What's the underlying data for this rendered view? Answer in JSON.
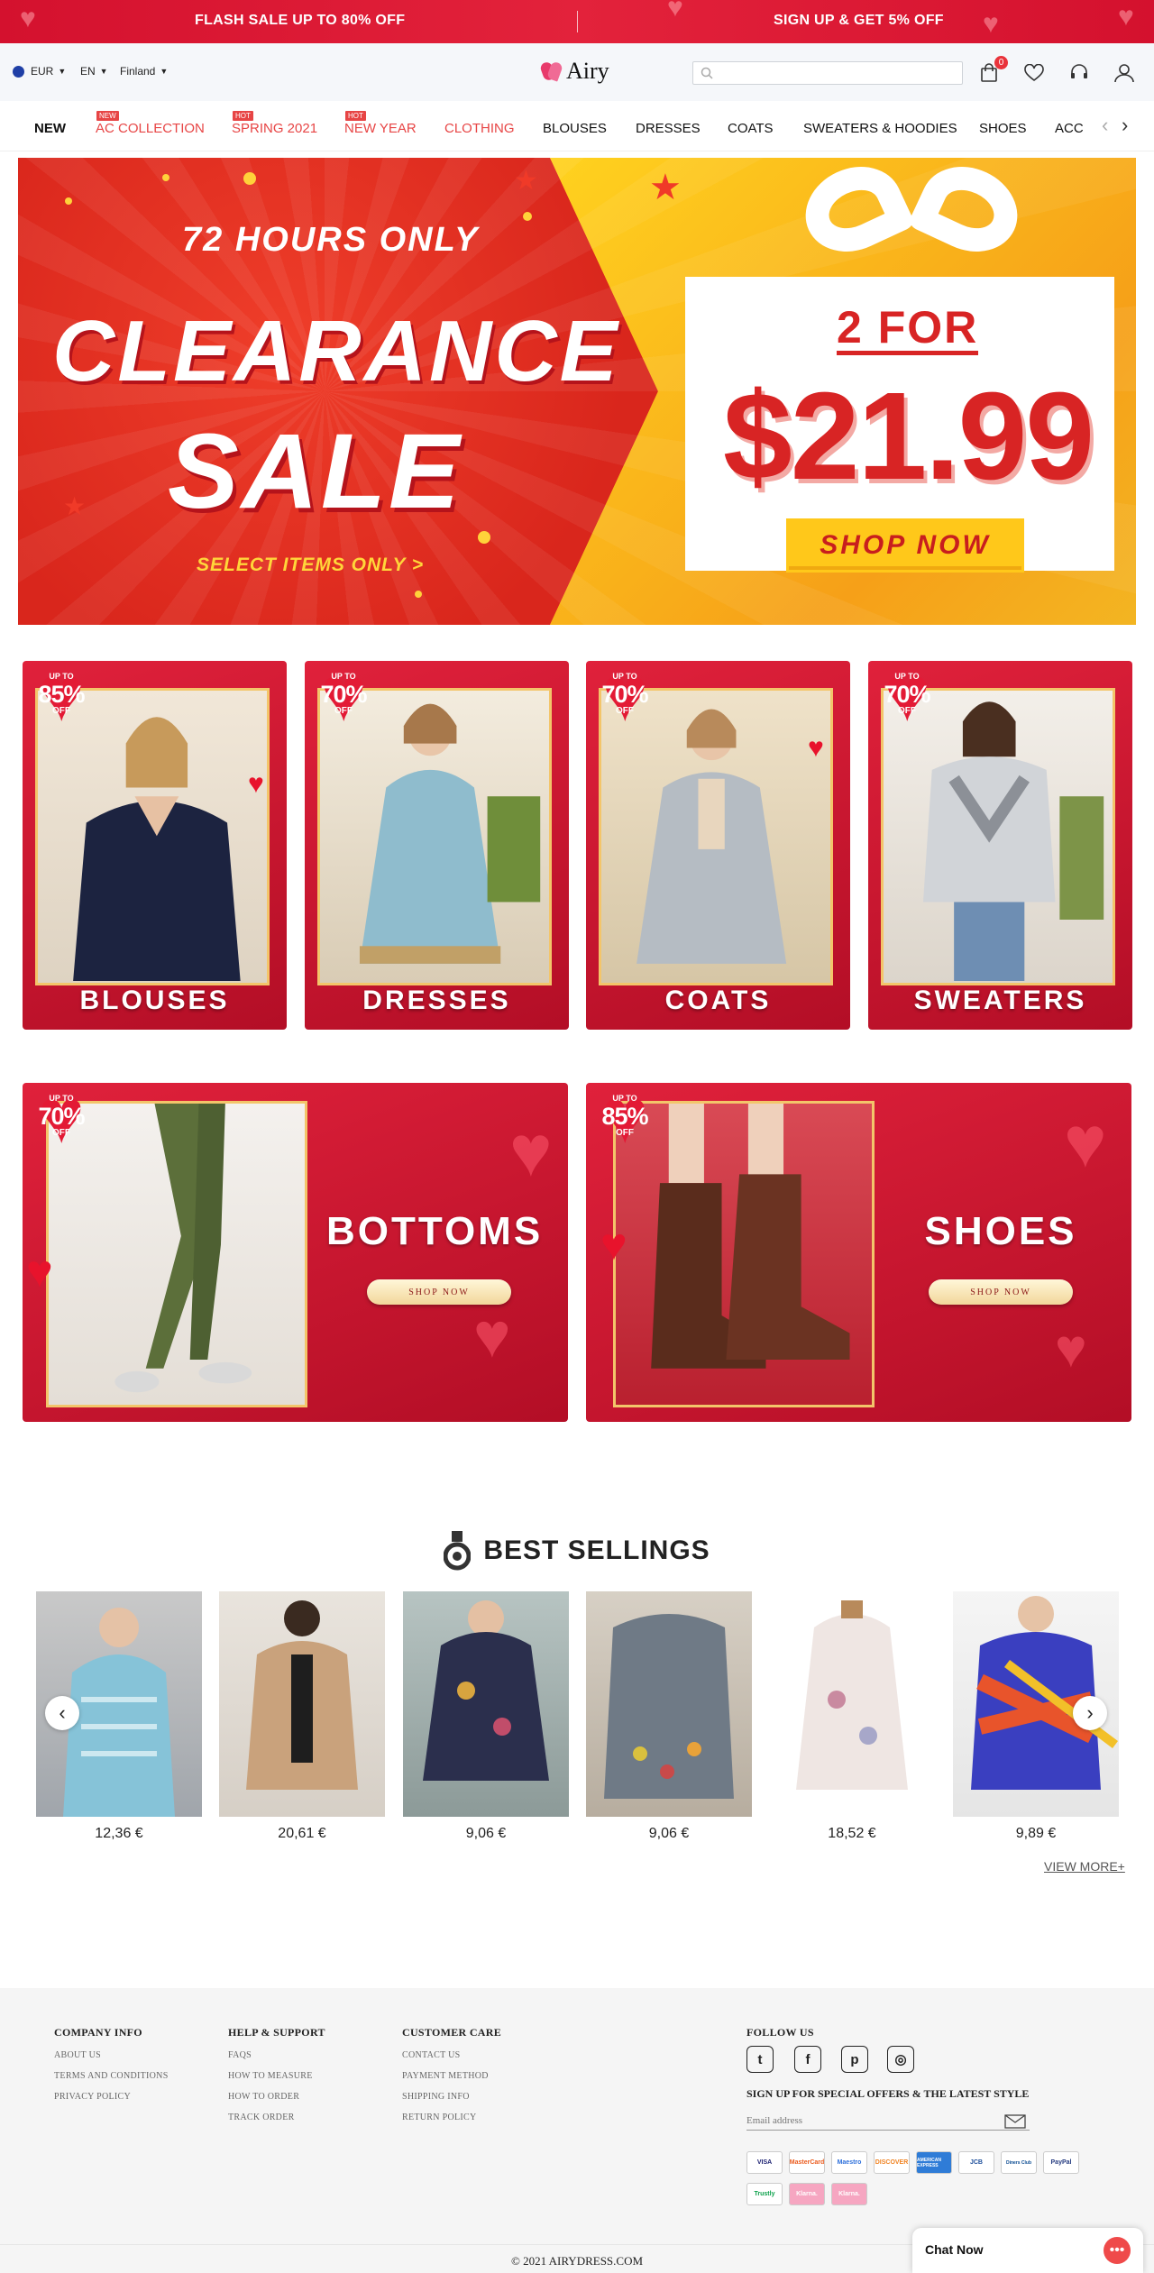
{
  "promo": {
    "left_text": "FLASH SALE UP TO 80% OFF",
    "right_text": "SIGN UP & GET 5% OFF"
  },
  "header": {
    "currency": "EUR",
    "language": "EN",
    "country": "Finland",
    "logo_text": "Airy",
    "search_placeholder": "",
    "cart_count": "0"
  },
  "nav": {
    "items": [
      {
        "label": "NEW"
      },
      {
        "label": "AC COLLECTION",
        "tag": "NEW"
      },
      {
        "label": "SPRING 2021",
        "tag": "HOT"
      },
      {
        "label": "NEW YEAR",
        "tag": "HOT"
      },
      {
        "label": "CLOTHING"
      },
      {
        "label": "BLOUSES"
      },
      {
        "label": "DRESSES"
      },
      {
        "label": "COATS"
      },
      {
        "label": "SWEATERS & HOODIES"
      },
      {
        "label": "SHOES"
      },
      {
        "label": "ACC"
      }
    ]
  },
  "hero": {
    "line1": "72 HOURS ONLY",
    "line2": "CLEARANCE",
    "line3": "SALE",
    "select": "SELECT ITEMS ONLY >",
    "offer": "2 FOR",
    "price": "$21.99",
    "cta": "SHOP NOW"
  },
  "categories": [
    {
      "label": "BLOUSES",
      "up": "UP TO",
      "pct": "85%",
      "off": "OFF"
    },
    {
      "label": "DRESSES",
      "up": "UP TO",
      "pct": "70%",
      "off": "OFF"
    },
    {
      "label": "COATS",
      "up": "UP TO",
      "pct": "70%",
      "off": "OFF"
    },
    {
      "label": "SWEATERS",
      "up": "UP TO",
      "pct": "70%",
      "off": "OFF"
    }
  ],
  "wide_categories": [
    {
      "label": "BOTTOMS",
      "cta": "SHOP NOW",
      "up": "UP TO",
      "pct": "70%",
      "off": "OFF"
    },
    {
      "label": "SHOES",
      "cta": "SHOP NOW",
      "up": "UP TO",
      "pct": "85%",
      "off": "OFF"
    }
  ],
  "best": {
    "title": "BEST SELLINGS",
    "view_more": "VIEW MORE+",
    "products": [
      {
        "price": "12,36 €"
      },
      {
        "price": "20,61 €"
      },
      {
        "price": "9,06 €"
      },
      {
        "price": "9,06 €"
      },
      {
        "price": "18,52 €"
      },
      {
        "price": "9,89 €"
      }
    ]
  },
  "footer": {
    "company": {
      "title": "COMPANY INFO",
      "links": [
        "ABOUT US",
        "TERMS AND CONDITIONS",
        "PRIVACY POLICY"
      ]
    },
    "help": {
      "title": "HELP & SUPPORT",
      "links": [
        "FAQS",
        "HOW TO MEASURE",
        "HOW TO ORDER",
        "TRACK ORDER"
      ]
    },
    "care": {
      "title": "CUSTOMER CARE",
      "links": [
        "CONTACT US",
        "PAYMENT METHOD",
        "SHIPPING INFO",
        "RETURN POLICY"
      ]
    },
    "follow": "FOLLOW US",
    "signup": "SIGN UP FOR SPECIAL OFFERS & THE LATEST STYLE",
    "email_placeholder": "Email address",
    "payments": [
      "VISA",
      "MasterCard",
      "Maestro",
      "DISCOVER",
      "AMERICAN EXPRESS",
      "JCB",
      "Diners Club",
      "PayPal",
      "Trustly",
      "Klarna.",
      "Klarna."
    ],
    "copyright": "© 2021 AIRYDRESS.COM"
  },
  "chat": {
    "label": "Chat Now"
  },
  "colors": {
    "brand_red": "#e3223b",
    "accent_yellow": "#ffc81a",
    "hero_red": "#d82424"
  }
}
